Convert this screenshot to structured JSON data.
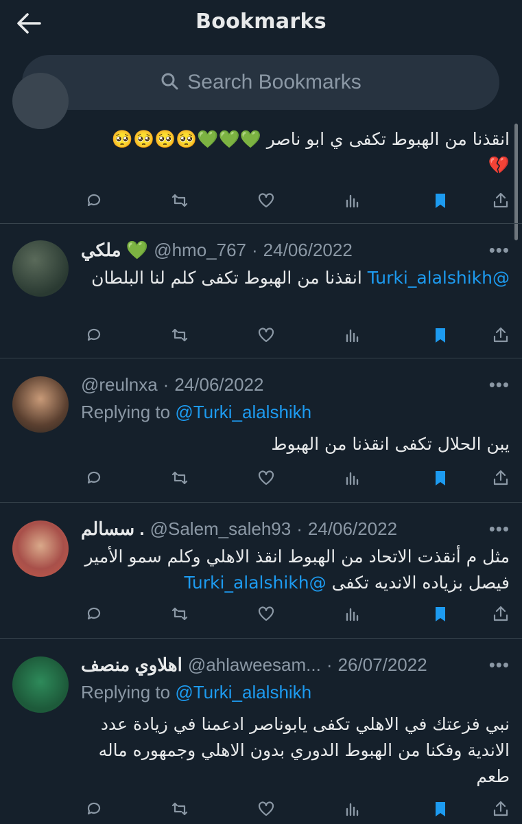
{
  "header": {
    "title": "Bookmarks"
  },
  "search": {
    "placeholder": "Search Bookmarks"
  },
  "colors": {
    "background": "#15202b",
    "accent": "#1d9bf0",
    "muted": "#8b98a5",
    "divider": "#38444d"
  },
  "tweets": [
    {
      "name": "",
      "handle": "",
      "date": "",
      "reply_prefix": "",
      "reply_to": "",
      "mention": "",
      "text": "انقذنا من الهبوط تكفى ي ابو ناصر 💚💚💚🥺🥺🥺🥺\n💔"
    },
    {
      "name": "ملكي 💚",
      "handle": "@hmo_767",
      "date": "24/06/2022",
      "reply_prefix": "",
      "reply_to": "",
      "mention": "@Turki_alalshikh",
      "text": " انقذنا من الهبوط تكفى كلم لنا البلطان"
    },
    {
      "name": "",
      "handle": "@reulnxa",
      "date": "24/06/2022",
      "reply_prefix": "Replying to",
      "reply_to": "@Turki_alalshikh",
      "mention": "",
      "text": "يبن الحلال تكفى انقذنا من الهبوط"
    },
    {
      "name": "سسالم .",
      "handle": "@Salem_saleh93",
      "date": "24/06/2022",
      "reply_prefix": "",
      "reply_to": "",
      "mention": "@Turki_alalshikh",
      "text": "مثل م أنقذت الاتحاد من الهبوط انقذ الاهلي وكلم سمو الأمير فيصل بزياده الانديه تكفى "
    },
    {
      "name": "اهلاوي منصف",
      "handle": "@ahlaweesam...",
      "date": "26/07/2022",
      "reply_prefix": "Replying to",
      "reply_to": "@Turki_alalshikh",
      "mention": "",
      "text": "نبي فزعتك في الاهلي تكفى يابوناصر ادعمنا في زيادة عدد الاندية وفكنا من الهبوط الدوري بدون الاهلي وجمهوره ماله طعم"
    }
  ],
  "more_label": "•••",
  "separator": "·"
}
